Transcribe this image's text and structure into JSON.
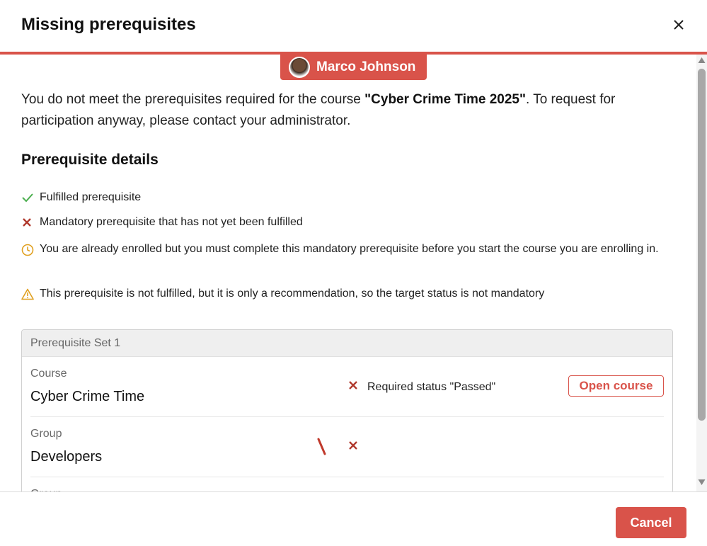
{
  "dialog": {
    "title": "Missing prerequisites",
    "close_icon": "close-icon",
    "accent_color": "#d9534a"
  },
  "user": {
    "name": "Marco Johnson"
  },
  "intro": {
    "text_before": "You do not meet the prerequisites required for the course ",
    "course_name": "\"Cyber Crime Time 2025\"",
    "text_after": ". To request for participation anyway, please contact your administrator."
  },
  "details": {
    "title": "Prerequisite details",
    "legend": [
      {
        "icon": "check-icon",
        "text": "Fulfilled prerequisite"
      },
      {
        "icon": "cross-icon",
        "text": "Mandatory prerequisite that has not yet been fulfilled"
      },
      {
        "icon": "clock-icon",
        "text": "You are already enrolled but you must complete this mandatory prerequisite before you start the course you are enrolling in."
      },
      {
        "icon": "warning-icon",
        "text": "This prerequisite is not fulfilled, but it is only a recommendation, so the target status is not mandatory"
      }
    ]
  },
  "prerequisite_set": {
    "title": "Prerequisite Set 1",
    "rows": [
      {
        "type": "Course",
        "name": "Cyber Crime Time",
        "status_icon": "cross-icon",
        "status": "Required status \"Passed\"",
        "action": "Open course"
      },
      {
        "type": "Group",
        "name": "Developers",
        "status_icon": "cross-icon",
        "status": ""
      },
      {
        "type": "Group",
        "name": "",
        "status_icon": "",
        "status": ""
      }
    ]
  },
  "footer": {
    "cancel_label": "Cancel"
  }
}
